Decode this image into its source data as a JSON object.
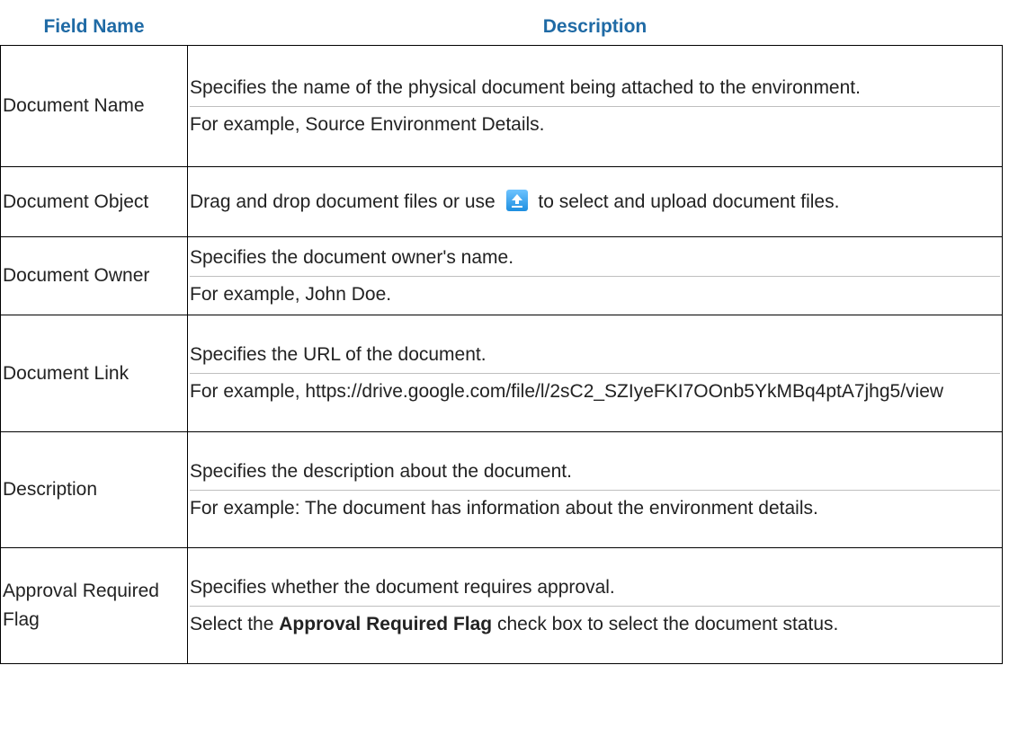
{
  "header": {
    "field_name": "Field Name",
    "description": "Description"
  },
  "rows": [
    {
      "field": "Document Name",
      "desc": [
        "Specifies the name of the physical document being attached to the environment.",
        "For example, Source Environment Details."
      ]
    },
    {
      "field": "Document Object",
      "desc_pre": "Drag and drop document files or use",
      "icon": "upload-icon",
      "desc_post": "to select and upload document files."
    },
    {
      "field": "Document Owner",
      "desc": [
        "Specifies the document owner's name.",
        "For example, John Doe."
      ]
    },
    {
      "field": "Document Link",
      "desc": [
        "Specifies the URL of the document.",
        "For example, https://drive.google.com/file/l/2sC2_SZIyeFKI7OOnb5YkMBq4ptA7jhg5/view"
      ]
    },
    {
      "field": "Description",
      "desc": [
        "Specifies the description about the document.",
        "For example: The document has information about the environment details."
      ]
    },
    {
      "field": "Approval Required Flag",
      "desc0": "Specifies whether the document requires approval.",
      "desc1_pre": "Select the",
      "desc1_bold": "Approval Required Flag",
      "desc1_post": "check box to select the document status."
    }
  ],
  "colors": {
    "header_text": "#1f6aa5",
    "border": "#000000",
    "icon": "#1e8fe0"
  }
}
